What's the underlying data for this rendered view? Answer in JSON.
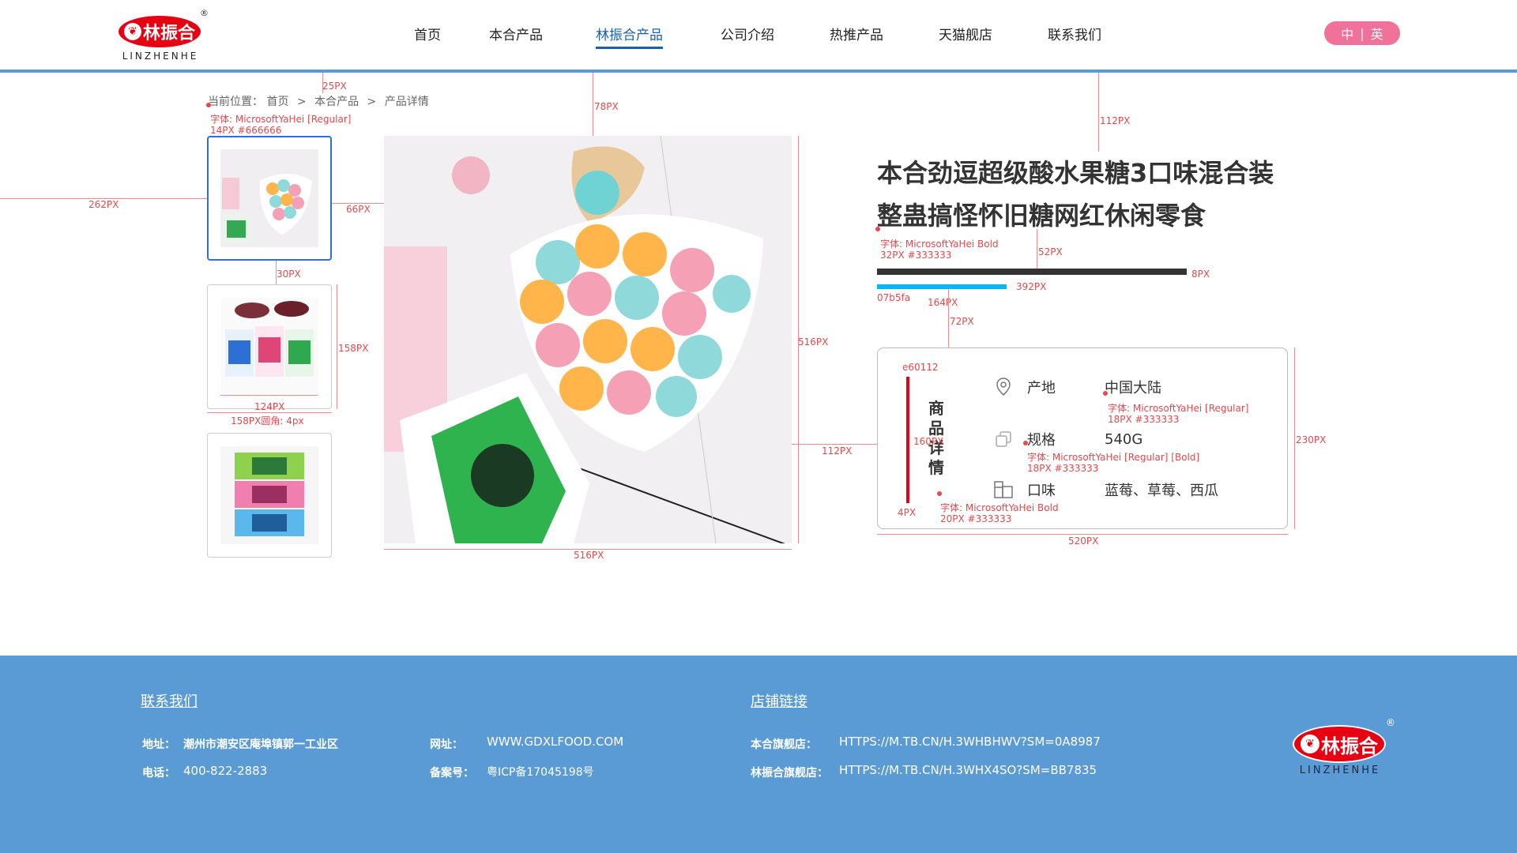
{
  "header": {
    "logo": {
      "cn": "林振合",
      "en": "LINZHENHE",
      "reg": "®"
    },
    "nav": [
      "首页",
      "本合产品",
      "林振合产品",
      "公司介绍",
      "热推产品",
      "天猫舰店",
      "联系我们"
    ],
    "active_index": 2,
    "lang": {
      "zh": "中",
      "sep": "|",
      "en": "英"
    }
  },
  "breadcrumb": {
    "prefix": "当前位置：",
    "items": [
      "首页",
      "本合产品",
      "产品详情"
    ],
    "sep": ">"
  },
  "product": {
    "title_line1": "本合劲逗超级酸水果糖3口味混合装",
    "title_line2": "整蛊搞怪怀旧糖网红休闲零食",
    "details_heading": "商品详情",
    "rows": [
      {
        "icon": "location-pin-icon",
        "key": "产地",
        "value": "中国大陆"
      },
      {
        "icon": "copy-squares-icon",
        "key": "规格",
        "value": "540G"
      },
      {
        "icon": "package-icon",
        "key": "口味",
        "value": "蓝莓、草莓、西瓜"
      }
    ]
  },
  "colors": {
    "accent_blue": "#07b5fa",
    "red": "#e60012",
    "footer_bg": "#5b9bd5",
    "text": "#333333"
  },
  "annotations": {
    "a_25": "25PX",
    "a_78": "78PX",
    "a_112_top": "112PX",
    "bc_font1": "字体: MicrosoftYaHei [Regular]",
    "bc_font2": "14PX #666666",
    "a_262": "262PX",
    "a_66": "66PX",
    "a_30": "30PX",
    "a_158": "158PX",
    "a_124": "124PX",
    "a_158r": "158PX圆角: 4px",
    "a_516r": "516PX",
    "a_516b": "516PX",
    "a_112_mid": "112PX",
    "title_font1": "字体: MicrosoftYaHei Bold",
    "title_font2": "32PX #333333",
    "a_52": "52PX",
    "a_8": "8PX",
    "a_392": "392PX",
    "a_07b": "07b5fa",
    "a_164": "164PX",
    "a_72": "72PX",
    "a_e600": "e60112",
    "a_160": "160PX",
    "a_4": "4PX",
    "a_230": "230PX",
    "a_520": "520PX",
    "v_font1": "字体: MicrosoftYaHei [Regular]",
    "v_font2": "18PX #333333",
    "k_font1": "字体: MicrosoftYaHei [Regular] [Bold]",
    "k_font2": "18PX #333333",
    "h_font1": "字体: MicrosoftYaHei Bold",
    "h_font2": "20PX #333333"
  },
  "footer": {
    "contact_title": "联系我们",
    "shop_title": "店铺链接",
    "address_label": "地址：",
    "address": "潮州市潮安区庵埠镇郭一工业区",
    "phone_label": "电话：",
    "phone": "400-822-2883",
    "web_label": "网址：",
    "web": "WWW.GDXLFOOD.COM",
    "icp_label": "备案号：",
    "icp": "粤ICP备17045198号",
    "shop1_label": "本合旗舰店：",
    "shop1": "HTTPS://M.TB.CN/H.3WHBHWV?SM=0A8987",
    "shop2_label": "林振合旗舰店：",
    "shop2": "HTTPS://M.TB.CN/H.3WHX4SO?SM=BB7835"
  }
}
